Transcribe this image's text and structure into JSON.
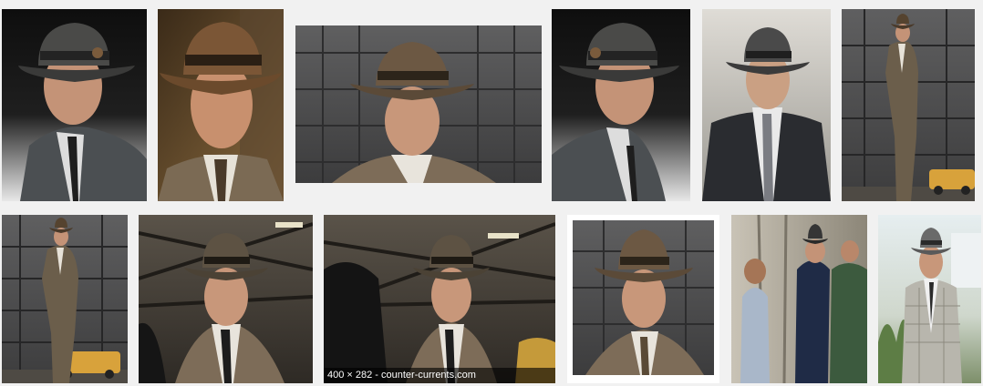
{
  "results": {
    "row1": [
      {
        "id": "r1-1",
        "scene": "studio-dark"
      },
      {
        "id": "r1-2",
        "scene": "closeup-brown-hat"
      },
      {
        "id": "r1-3",
        "scene": "building-backdrop"
      },
      {
        "id": "r1-4",
        "scene": "studio-dark"
      },
      {
        "id": "r1-5",
        "scene": "misty-suit"
      },
      {
        "id": "r1-6",
        "scene": "fullbody-street"
      }
    ],
    "row2": [
      {
        "id": "r2-1",
        "scene": "fullbody-street"
      },
      {
        "id": "r2-2",
        "scene": "warehouse"
      },
      {
        "id": "r2-3",
        "scene": "warehouse"
      },
      {
        "id": "r2-4",
        "scene": "building-backdrop"
      },
      {
        "id": "r2-5",
        "scene": "subway"
      },
      {
        "id": "r2-6",
        "scene": "plaid-outdoor"
      }
    ],
    "hovered": {
      "meta": "400 × 282 - counter-currents.com"
    }
  },
  "colors": {
    "page_bg": "#f1f1f1",
    "suit_gray": "#5a5e61",
    "suit_brown": "#7b6b57",
    "hat_dark": "#3b3b3a",
    "hat_brown": "#6a4a2e",
    "skin": "#c9977a"
  }
}
